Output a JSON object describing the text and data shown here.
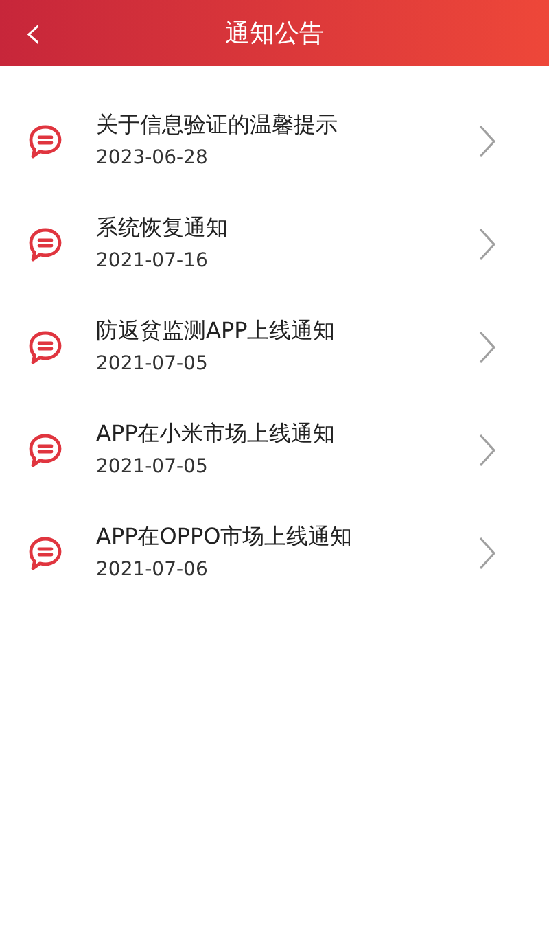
{
  "header": {
    "back": "‹",
    "title": "通知公告"
  },
  "notices": [
    {
      "title": "关于信息验证的温馨提示",
      "date": "2023-06-28"
    },
    {
      "title": "系统恢复通知",
      "date": "2021-07-16"
    },
    {
      "title": "防返贫监测APP上线通知",
      "date": "2021-07-05"
    },
    {
      "title": "APP在小米市场上线通知",
      "date": "2021-07-05"
    },
    {
      "title": "APP在OPPO市场上线通知",
      "date": "2021-07-06"
    }
  ]
}
